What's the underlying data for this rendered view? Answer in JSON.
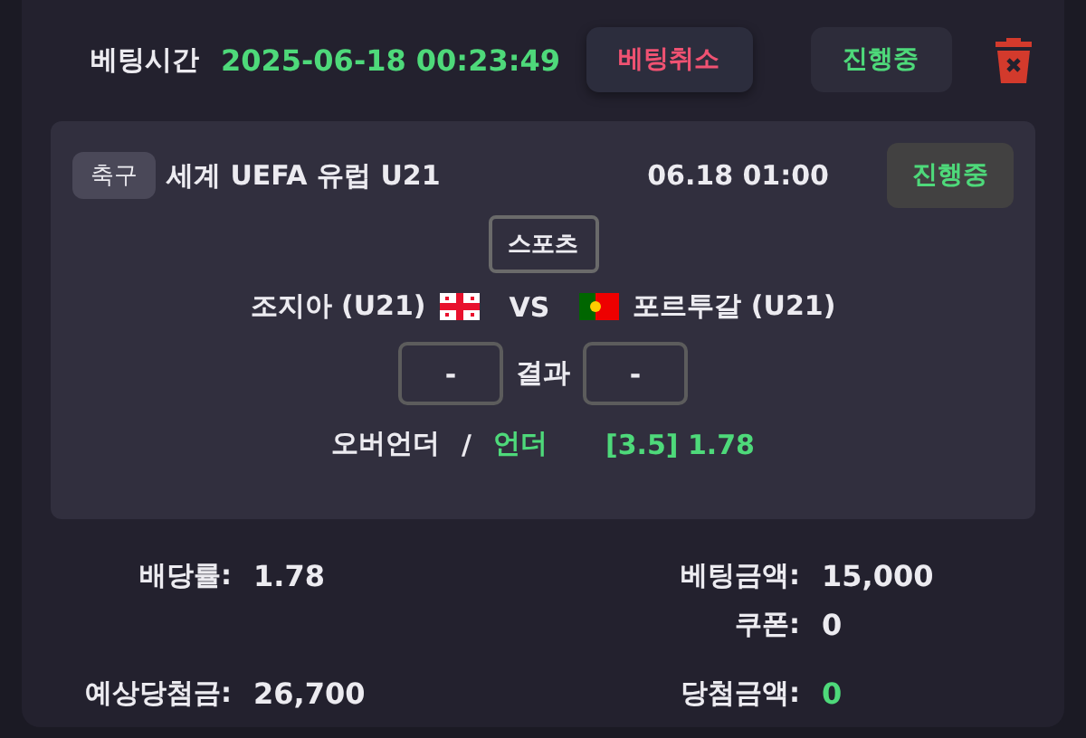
{
  "header": {
    "label": "베팅시간",
    "time": "2025-06-18 00:23:49",
    "cancel_button": "베팅취소",
    "status_button": "진행중"
  },
  "bet": {
    "sport": "축구",
    "league": "세계 UEFA 유럽 U21",
    "date": "06.18 01:00",
    "status": "진행중",
    "category": "스포츠",
    "home": "조지아 (U21)",
    "vs": "VS",
    "away": "포르투갈 (U21)",
    "home_score": "-",
    "result_label": "결과",
    "away_score": "-",
    "market": "오버언더",
    "separator": "/",
    "pick": "언더",
    "odds": "[3.5] 1.78"
  },
  "summary": [
    {
      "left": {
        "label": "배당률:",
        "value": "1.78",
        "highlight": false
      },
      "right": {
        "label": "베팅금액:",
        "value": "15,000",
        "highlight": false
      }
    },
    {
      "right": {
        "label": "쿠폰:",
        "value": "0",
        "highlight": false
      }
    },
    {
      "left": {
        "label": "예상당첨금:",
        "value": "26,700",
        "highlight": false
      },
      "right": {
        "label": "당첨금액:",
        "value": "0",
        "highlight": true
      }
    }
  ]
}
